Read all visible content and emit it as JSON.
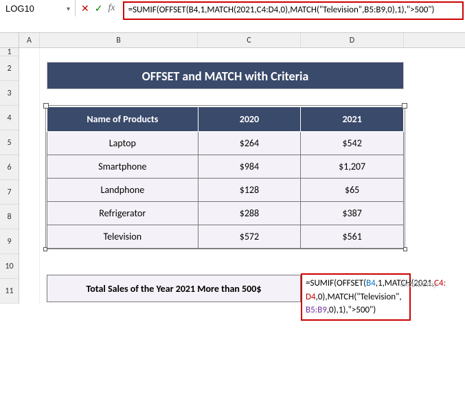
{
  "nameBox": "LOG10",
  "formulaBar": "=SUMIF(OFFSET(B4,1,MATCH(2021,C4:D4,0),MATCH(\"Television\",B5:B9,0),1),\">500\")",
  "columns": [
    "A",
    "B",
    "C",
    "D"
  ],
  "rows": [
    "1",
    "2",
    "3",
    "4",
    "5",
    "6",
    "7",
    "8",
    "9",
    "10",
    "11"
  ],
  "title": "OFFSET and MATCH with Criteria",
  "headers": {
    "name": "Name of Products",
    "y2020": "2020",
    "y2021": "2021"
  },
  "products": [
    {
      "name": "Laptop",
      "y2020": "$264",
      "y2021": "$542"
    },
    {
      "name": "Smartphone",
      "y2020": "$984",
      "y2021": "$1,207"
    },
    {
      "name": "Landphone",
      "y2020": "$128",
      "y2021": "$65"
    },
    {
      "name": "Refrigerator",
      "y2020": "$288",
      "y2021": "$387"
    },
    {
      "name": "Television",
      "y2020": "$572",
      "y2021": "$561"
    }
  ],
  "footerLabel": "Total Sales of the Year 2021 More than 500$",
  "cellFormula": {
    "p1": "=SUMIF(OFFSET(",
    "b4": "B4",
    "p2": ",1,MATCH(2021,",
    "c4d4a": "C4:",
    "c4d4b": "D4",
    "p3": ",0),MATCH(\"Television\",",
    "b5b9": "B5:B9",
    "p4": ",0),1),\">500\")"
  },
  "watermark": "exceldemy",
  "icons": {
    "cancel": "✕",
    "enter": "✓",
    "fx": "fx",
    "dropdown": "▾"
  }
}
